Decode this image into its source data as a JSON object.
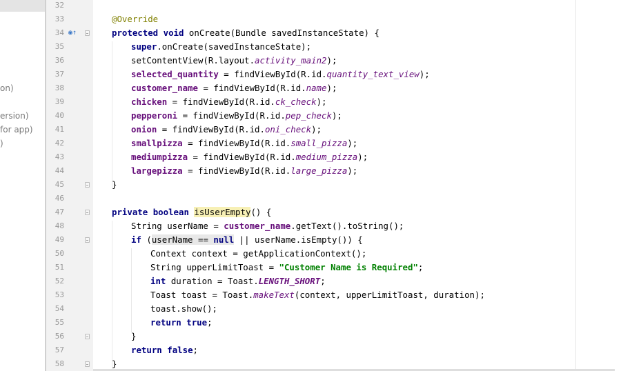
{
  "project_panel": {
    "items": [
      {
        "text": "on)"
      },
      {
        "text": "ersion)"
      },
      {
        "text": " for app)"
      },
      {
        "text": ")"
      }
    ]
  },
  "gutter": {
    "line_numbers": [
      "32",
      "33",
      "34",
      "35",
      "36",
      "37",
      "38",
      "39",
      "40",
      "41",
      "42",
      "43",
      "44",
      "45",
      "46",
      "47",
      "48",
      "49",
      "50",
      "51",
      "52",
      "53",
      "54",
      "55",
      "56",
      "57",
      "58"
    ],
    "override_icon": "override-method-icon"
  },
  "code": {
    "lines": [
      {
        "indent": 0,
        "tokens": []
      },
      {
        "indent": 1,
        "tokens": [
          {
            "t": "@Override",
            "c": "ann"
          }
        ]
      },
      {
        "indent": 1,
        "tokens": [
          {
            "t": "protected",
            "c": "kw"
          },
          {
            "t": " "
          },
          {
            "t": "void",
            "c": "kw"
          },
          {
            "t": " onCreate(Bundle savedInstanceState) {"
          }
        ]
      },
      {
        "indent": 2,
        "tokens": [
          {
            "t": "super",
            "c": "kw"
          },
          {
            "t": ".onCreate(savedInstanceState);"
          }
        ]
      },
      {
        "indent": 2,
        "tokens": [
          {
            "t": "setContentView(R.layout."
          },
          {
            "t": "activity_main2",
            "c": "ital"
          },
          {
            "t": ");"
          }
        ]
      },
      {
        "indent": 2,
        "tokens": [
          {
            "t": "selected_quantity",
            "c": "fld"
          },
          {
            "t": " = findViewById(R.id."
          },
          {
            "t": "quantity_text_view",
            "c": "ital"
          },
          {
            "t": ");"
          }
        ]
      },
      {
        "indent": 2,
        "tokens": [
          {
            "t": "customer_name",
            "c": "fld"
          },
          {
            "t": " = findViewById(R.id."
          },
          {
            "t": "name",
            "c": "ital"
          },
          {
            "t": ");"
          }
        ]
      },
      {
        "indent": 2,
        "tokens": [
          {
            "t": "chicken",
            "c": "fld"
          },
          {
            "t": " = findViewById(R.id."
          },
          {
            "t": "ck_check",
            "c": "ital"
          },
          {
            "t": ");"
          }
        ]
      },
      {
        "indent": 2,
        "tokens": [
          {
            "t": "pepperoni",
            "c": "fld"
          },
          {
            "t": " = findViewById(R.id."
          },
          {
            "t": "pep_check",
            "c": "ital"
          },
          {
            "t": ");"
          }
        ]
      },
      {
        "indent": 2,
        "tokens": [
          {
            "t": "onion",
            "c": "fld"
          },
          {
            "t": " = findViewById(R.id."
          },
          {
            "t": "oni_check",
            "c": "ital"
          },
          {
            "t": ");"
          }
        ]
      },
      {
        "indent": 2,
        "tokens": [
          {
            "t": "smallpizza",
            "c": "fld"
          },
          {
            "t": " = findViewById(R.id."
          },
          {
            "t": "small_pizza",
            "c": "ital"
          },
          {
            "t": ");"
          }
        ]
      },
      {
        "indent": 2,
        "tokens": [
          {
            "t": "mediumpizza",
            "c": "fld"
          },
          {
            "t": " = findViewById(R.id."
          },
          {
            "t": "medium_pizza",
            "c": "ital"
          },
          {
            "t": ");"
          }
        ]
      },
      {
        "indent": 2,
        "tokens": [
          {
            "t": "largepizza",
            "c": "fld"
          },
          {
            "t": " = findViewById(R.id."
          },
          {
            "t": "large_pizza",
            "c": "ital"
          },
          {
            "t": ");"
          }
        ]
      },
      {
        "indent": 1,
        "tokens": [
          {
            "t": "}"
          }
        ]
      },
      {
        "indent": 0,
        "tokens": []
      },
      {
        "indent": 1,
        "tokens": [
          {
            "t": "private",
            "c": "kw"
          },
          {
            "t": " "
          },
          {
            "t": "boolean",
            "c": "kw"
          },
          {
            "t": " "
          },
          {
            "t": "isUserEmpty",
            "c": "hl-y"
          },
          {
            "t": "() {"
          }
        ]
      },
      {
        "indent": 2,
        "tokens": [
          {
            "t": "String userName = "
          },
          {
            "t": "customer_name",
            "c": "fld"
          },
          {
            "t": ".getText().toString();"
          }
        ]
      },
      {
        "indent": 2,
        "tokens": [
          {
            "t": "if",
            "c": "kw"
          },
          {
            "t": " ("
          },
          {
            "t": "userName == ",
            "c": "hl-g"
          },
          {
            "t": "null",
            "c": "kw hl-g"
          },
          {
            "t": " || userName.isEmpty()) {"
          }
        ]
      },
      {
        "indent": 3,
        "tokens": [
          {
            "t": "Context context = getApplicationContext();"
          }
        ]
      },
      {
        "indent": 3,
        "tokens": [
          {
            "t": "String upperLimitToast = "
          },
          {
            "t": "\"Customer Name is Required\"",
            "c": "str"
          },
          {
            "t": ";"
          }
        ]
      },
      {
        "indent": 3,
        "tokens": [
          {
            "t": "int",
            "c": "kw"
          },
          {
            "t": " duration = Toast."
          },
          {
            "t": "LENGTH_SHORT",
            "c": "sfld"
          },
          {
            "t": ";"
          }
        ]
      },
      {
        "indent": 3,
        "tokens": [
          {
            "t": "Toast toast = Toast."
          },
          {
            "t": "makeText",
            "c": "ital"
          },
          {
            "t": "(context, upperLimitToast, duration);"
          }
        ]
      },
      {
        "indent": 3,
        "tokens": [
          {
            "t": "toast.show();"
          }
        ]
      },
      {
        "indent": 3,
        "tokens": [
          {
            "t": "return",
            "c": "kw"
          },
          {
            "t": " "
          },
          {
            "t": "true",
            "c": "kw"
          },
          {
            "t": ";"
          }
        ]
      },
      {
        "indent": 2,
        "tokens": [
          {
            "t": "}"
          }
        ]
      },
      {
        "indent": 2,
        "tokens": [
          {
            "t": "return",
            "c": "kw"
          },
          {
            "t": " "
          },
          {
            "t": "false",
            "c": "kw"
          },
          {
            "t": ";"
          }
        ]
      },
      {
        "indent": 1,
        "tokens": [
          {
            "t": "}"
          }
        ]
      }
    ]
  },
  "colors": {
    "keyword": "#000080",
    "field": "#660e7a",
    "string": "#008000",
    "annotation": "#808000",
    "usage_highlight": "#f7f0b5",
    "gutter_bg": "#f2f2f2"
  }
}
